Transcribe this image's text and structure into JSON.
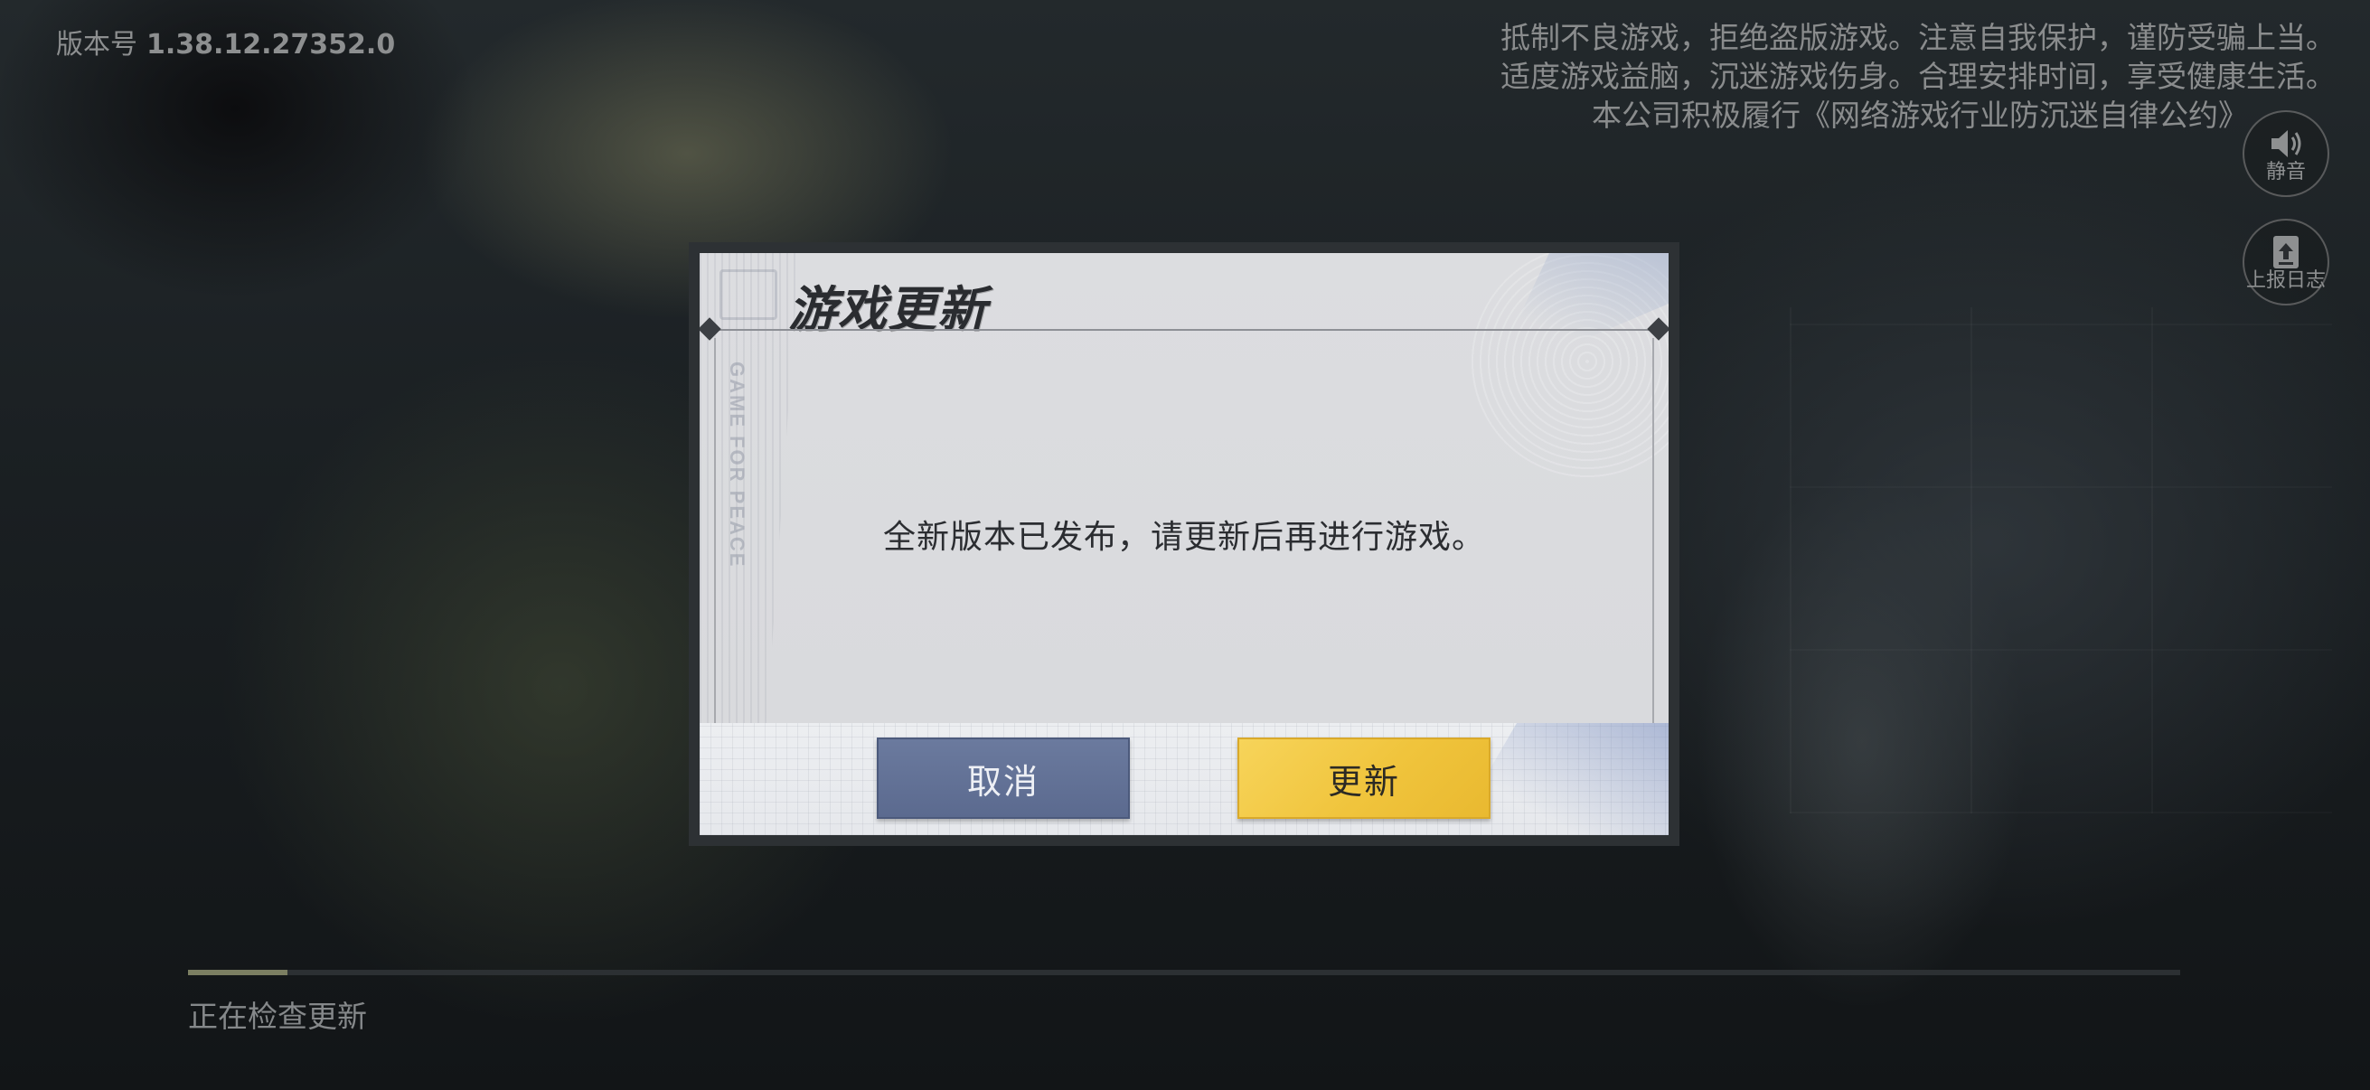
{
  "header": {
    "version_label": "版本号",
    "version_number": "1.38.12.27352.0"
  },
  "notice": {
    "line1": "抵制不良游戏，拒绝盗版游戏。注意自我保护，谨防受骗上当。",
    "line2": "适度游戏益脑，沉迷游戏伤身。合理安排时间，享受健康生活。",
    "line3": "本公司积极履行《网络游戏行业防沉迷自律公约》"
  },
  "side_buttons": {
    "mute_label": "静音",
    "log_label": "上报日志"
  },
  "dialog": {
    "title": "游戏更新",
    "watermark": "GAME FOR PEACE",
    "message": "全新版本已发布，请更新后再进行游戏。",
    "cancel_label": "取消",
    "update_label": "更新"
  },
  "loading": {
    "status_text": "正在检查更新",
    "progress": 0.05
  },
  "colors": {
    "cancel_button": "#5b6a8f",
    "update_button": "#f0c43c",
    "dialog_bg": "#dcdde0"
  }
}
